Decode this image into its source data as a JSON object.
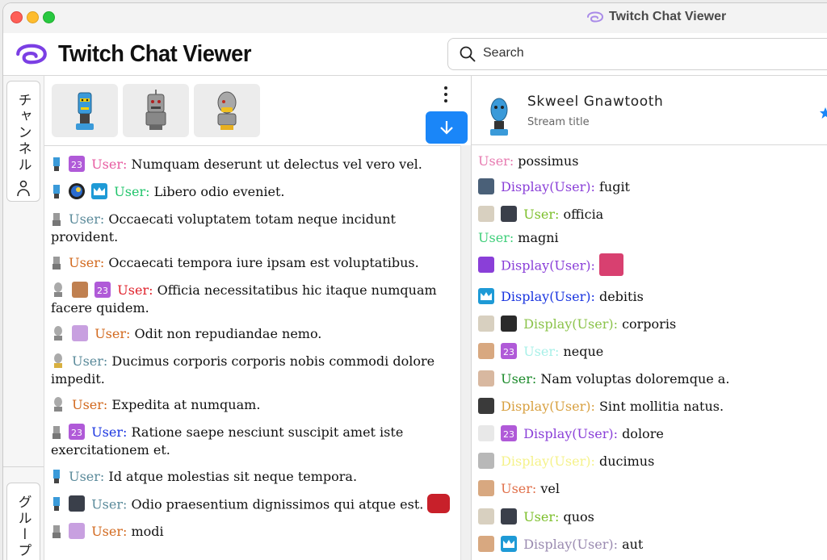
{
  "window": {
    "title": "Twitch Chat Viewer"
  },
  "header": {
    "app_title": "Twitch Chat Viewer",
    "search_placeholder": "Search"
  },
  "sidebar": {
    "tab_channels": "チャンネル",
    "tab_groups": "グループ"
  },
  "colors": {
    "accent": "#1a86f8",
    "brand": "#7b3fe4"
  },
  "stream": {
    "name": "Skweel Gnawtooth",
    "title": "Stream title"
  },
  "left_messages": [
    {
      "user": "User:",
      "text": "Numquam deserunt ut delectus vel vero vel.",
      "color": "#e75aa0"
    },
    {
      "user": "User:",
      "text": "Libero odio eveniet.",
      "color": "#21c46b"
    },
    {
      "user": "User:",
      "text": "Occaecati voluptatem totam neque incidunt provident.",
      "color": "#5a8a9a"
    },
    {
      "user": "User:",
      "text": "Occaecati tempora iure ipsam est voluptatibus.",
      "color": "#d2691e"
    },
    {
      "user": "User:",
      "text": "Officia necessitatibus hic itaque numquam facere quidem.",
      "color": "#e0202a"
    },
    {
      "user": "User:",
      "text": "Odit non repudiandae nemo.",
      "color": "#d2691e"
    },
    {
      "user": "User:",
      "text": "Ducimus corporis corporis nobis commodi dolore impedit.",
      "color": "#5a8a9a"
    },
    {
      "user": "User:",
      "text": "Expedita at numquam.",
      "color": "#d2691e"
    },
    {
      "user": "User:",
      "text": "Ratione saepe nesciunt suscipit amet iste exercitationem et.",
      "color": "#1a35e0"
    },
    {
      "user": "User:",
      "text": "Id atque molestias sit neque tempora.",
      "color": "#5a8a9a"
    },
    {
      "user": "User:",
      "text": "Odio praesentium dignissimos qui atque est.",
      "color": "#5a8a9a"
    },
    {
      "user": "User:",
      "text": "modi",
      "color": "#d2691e"
    }
  ],
  "right_messages": [
    {
      "user": "User:",
      "text": "possimus",
      "color": "#e77ab0"
    },
    {
      "user": "Display(User):",
      "text": "fugit",
      "color": "#8a3fd8"
    },
    {
      "user": "User:",
      "text": "officia",
      "color": "#7cbf2a"
    },
    {
      "user": "User:",
      "text": "magni",
      "color": "#3fcf7a"
    },
    {
      "user": "Display(User):",
      "text": "",
      "color": "#8a3fd8"
    },
    {
      "user": "Display(User):",
      "text": "debitis",
      "color": "#1a35e0"
    },
    {
      "user": "Display(User):",
      "text": "corporis",
      "color": "#8bc34a"
    },
    {
      "user": "User:",
      "text": "neque",
      "color": "#a8f0e8"
    },
    {
      "user": "User:",
      "text": "Nam voluptas doloremque a.",
      "color": "#1b8a2a"
    },
    {
      "user": "Display(User):",
      "text": "Sint mollitia natus.",
      "color": "#d8a040"
    },
    {
      "user": "Display(User):",
      "text": "dolore",
      "color": "#8a3fd8"
    },
    {
      "user": "Display(User):",
      "text": "ducimus",
      "color": "#f5f28a"
    },
    {
      "user": "User:",
      "text": "vel",
      "color": "#e0704a"
    },
    {
      "user": "User:",
      "text": "quos",
      "color": "#7cbf2a"
    },
    {
      "user": "Display(User):",
      "text": "aut",
      "color": "#9a8ab0"
    }
  ]
}
